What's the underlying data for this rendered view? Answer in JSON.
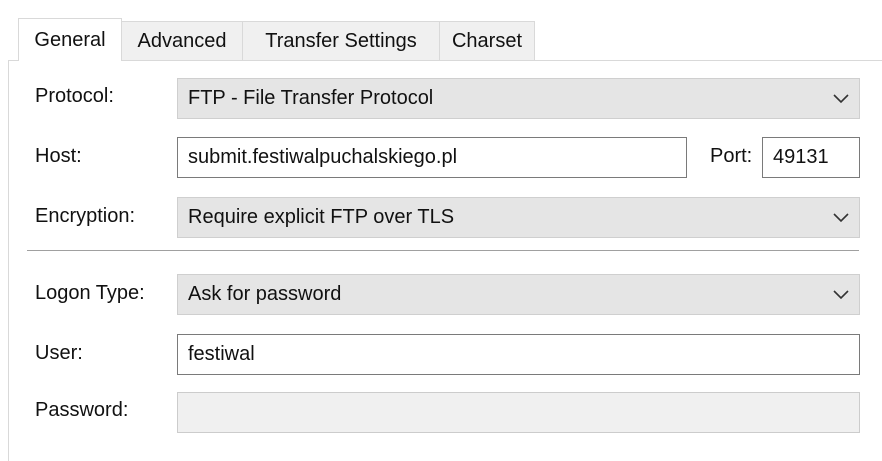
{
  "tabs": [
    {
      "label": "General",
      "active": true
    },
    {
      "label": "Advanced",
      "active": false
    },
    {
      "label": "Transfer Settings",
      "active": false
    },
    {
      "label": "Charset",
      "active": false
    }
  ],
  "general": {
    "protocol": {
      "label": "Protocol:",
      "value": "FTP - File Transfer Protocol"
    },
    "host": {
      "label": "Host:",
      "value": "submit.festiwalpuchalskiego.pl"
    },
    "port": {
      "label": "Port:",
      "value": "49131"
    },
    "encryption": {
      "label": "Encryption:",
      "value": "Require explicit FTP over TLS"
    },
    "logon_type": {
      "label": "Logon Type:",
      "value": "Ask for password"
    },
    "user": {
      "label": "User:",
      "value": "festiwal"
    },
    "password": {
      "label": "Password:",
      "value": ""
    }
  },
  "icons": {
    "dropdown": "chevron-down-icon"
  },
  "colors": {
    "combo_bg": "#e5e5e5",
    "input_border": "#7a7a7a",
    "disabled_bg": "#f0f0f0"
  }
}
